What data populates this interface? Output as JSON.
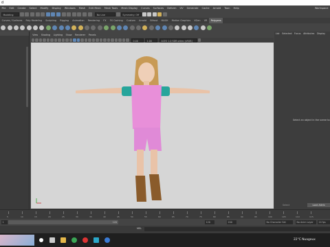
{
  "titlebar": {
    "title": "d"
  },
  "menubar": {
    "items": [
      "File",
      "Edit",
      "Create",
      "Select",
      "Modify",
      "Display",
      "Windows",
      "Mesh",
      "Edit Mesh",
      "Mesh Tools",
      "Mesh Display",
      "Curves",
      "Surfaces",
      "Deform",
      "UV",
      "Generate",
      "Cache",
      "Arnold",
      "Toon",
      "Help"
    ],
    "workspace": "Workspace"
  },
  "statusline": {
    "mode": "Modeling",
    "live_surface": "No Live Surface",
    "symmetry": "Symmetry: Off"
  },
  "shelf": {
    "tabs": [
      "Curves / Surfaces",
      "Poly Modeling",
      "Sculpting",
      "Rigging",
      "Animation",
      "Rendering",
      "FX",
      "FX Caching",
      "Custom",
      "Arnold",
      "Bifrost",
      "MASH",
      "Motion Graphics",
      "XGen",
      "VR",
      "Polygons"
    ],
    "active_tab": "Polygons"
  },
  "viewport": {
    "menu": [
      "View",
      "Shading",
      "Lighting",
      "Show",
      "Renderer",
      "Panels"
    ],
    "gamma_field": "ACES 1.0 SDR-video (sRGB)",
    "value_a": "0.00",
    "value_b": "1.00"
  },
  "rightpanel": {
    "tabs": [
      "List",
      "Selected",
      "Focus",
      "Attributes",
      "Display"
    ],
    "message": "Select an object in the scene to",
    "select_btn": "Select",
    "load_btn": "Load Attrib"
  },
  "timeslider": {
    "ticks": [
      "5",
      "10",
      "15",
      "20",
      "25",
      "30",
      "35",
      "40",
      "45",
      "50",
      "55",
      "60",
      "65",
      "70",
      "75",
      "80",
      "85",
      "90",
      "95",
      "100",
      "105",
      "110",
      "115"
    ]
  },
  "rangeslider": {
    "start": "1",
    "range_end_label": "120",
    "end": "120",
    "end2": "200",
    "character_set": "No Character Set",
    "anim_layer": "No Anim Layer",
    "fps": "24 fps"
  },
  "cmdline": {
    "label": "MEL"
  },
  "taskbar": {
    "weather": "22°C  Nuageux"
  },
  "colors": {
    "viewport_bg": "#d6d6d6",
    "ui_bg": "#444444",
    "shirt": "#e88fd9",
    "sleeve": "#27a59b"
  }
}
